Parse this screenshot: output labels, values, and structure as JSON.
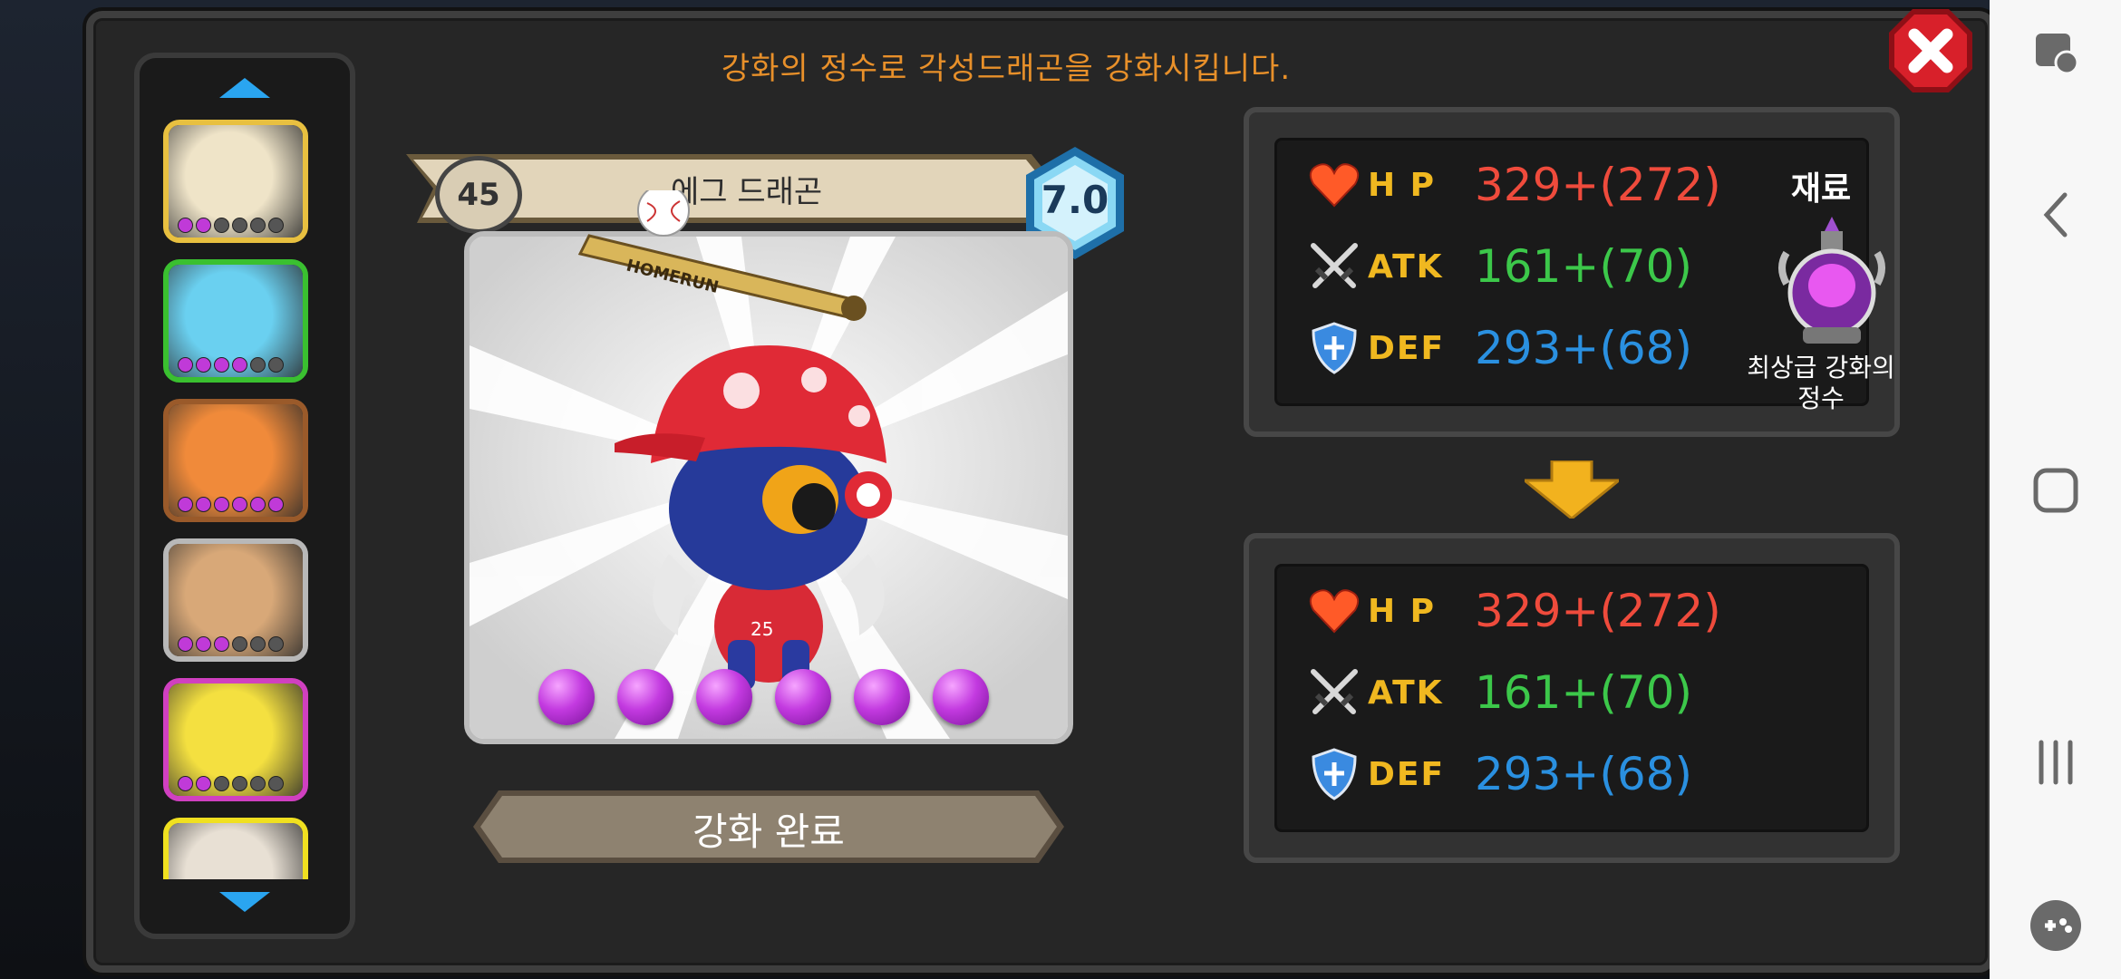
{
  "instruction": "강화의 정수로 각성드래곤을 강화시킵니다.",
  "dragon": {
    "level": "45",
    "name": "에그 드래곤",
    "grade": "7.0",
    "enhance_orbs": 6,
    "bat_text": "HOMERUN"
  },
  "dragon_list": {
    "slots": [
      {
        "name": "slot-1",
        "frame_color": "#e8c040",
        "stars": 2
      },
      {
        "name": "slot-2",
        "frame_color": "#3ac030",
        "stars": 4
      },
      {
        "name": "slot-3",
        "frame_color": "#9a5a2a",
        "stars": 6
      },
      {
        "name": "slot-4",
        "frame_color": "#b8b8b8",
        "stars": 3
      },
      {
        "name": "slot-5",
        "frame_color": "#d040c0",
        "stars": 2
      },
      {
        "name": "slot-6",
        "frame_color": "#f0e020",
        "stars": 0
      }
    ]
  },
  "complete_button": "강화 완료",
  "current_stats": {
    "hp_label": "H P",
    "hp_value": "329+(272)",
    "atk_label": "ATK",
    "atk_value": "161+(70)",
    "def_label": "DEF",
    "def_value": "293+(68)"
  },
  "material": {
    "title": "재료",
    "name_line1": "최상급 강화의",
    "name_line2": "정수"
  },
  "next_stats": {
    "hp_label": "H P",
    "hp_value": "329+(272)",
    "atk_label": "ATK",
    "atk_value": "161+(70)",
    "def_label": "DEF",
    "def_value": "293+(68)"
  },
  "colors": {
    "instruction": "#e8902a",
    "hp": "#ef4b3c",
    "atk": "#3cc84a",
    "def": "#2a90e0",
    "stat_label": "#f0b820",
    "list_arrow": "#2aa5f0",
    "orb": "#c33ae0",
    "close": "#d8202a"
  },
  "nav_icons": [
    "game-tools-icon",
    "back-icon",
    "home-icon",
    "recents-icon",
    "game-launcher-icon"
  ]
}
